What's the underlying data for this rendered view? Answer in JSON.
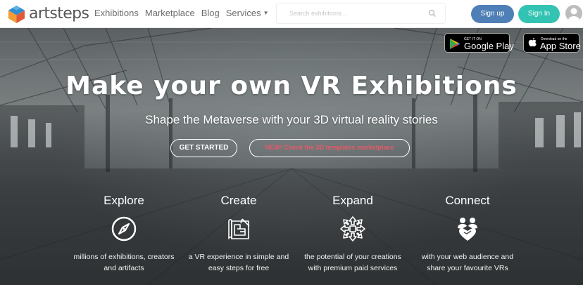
{
  "header": {
    "logo_text": "artsteps",
    "nav": {
      "exhibitions": "Exhibitions",
      "marketplace": "Marketplace",
      "blog": "Blog",
      "services": "Services"
    },
    "search": {
      "placeholder": "Search exhibitions...",
      "value": ""
    },
    "signup_label": "Sign up",
    "signin_label": "Sign In"
  },
  "stores": {
    "google": {
      "small": "GET IT ON",
      "big": "Google Play"
    },
    "apple": {
      "small": "Download on the",
      "big": "App Store"
    }
  },
  "hero": {
    "title": "Make your own VR Exhibitions",
    "subtitle": "Shape the Metaverse with your 3D virtual reality stories",
    "cta_start": "GET STARTED",
    "cta_marketplace": "NEW! Check the 3D templates marketplace"
  },
  "features": [
    {
      "title": "Explore",
      "icon": "compass-icon",
      "line1": "millions of exhibitions, creators",
      "line2": "and artifacts"
    },
    {
      "title": "Create",
      "icon": "blueprint-icon",
      "line1": "a VR experience in simple and",
      "line2": "easy steps for free"
    },
    {
      "title": "Expand",
      "icon": "expand-arrows-icon",
      "line1": "the potential of your creations",
      "line2": "with premium paid services"
    },
    {
      "title": "Connect",
      "icon": "people-heart-icon",
      "line1": "with your web audience and",
      "line2": "share your favourite VRs"
    }
  ],
  "colors": {
    "signup": "#4e7fb6",
    "signin": "#33c3b3",
    "marketplace_cta_text": "#e8596a"
  }
}
